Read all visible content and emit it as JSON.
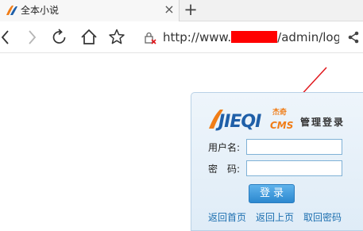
{
  "browser": {
    "tab": {
      "title": "全本小说",
      "close_label": "×"
    },
    "new_tab_label": "+",
    "address": {
      "url_prefix": "http://www.",
      "url_suffix": "/admin/login"
    }
  },
  "login": {
    "logo": {
      "brand": "JIEQI",
      "sub": "CMS",
      "small": "杰奇"
    },
    "title": "管理登录",
    "username_label": "用户名:",
    "password_label": "密　码:",
    "username_value": "",
    "password_value": "",
    "submit_label": "登录",
    "links": {
      "home": "返回首页",
      "prev": "返回上页",
      "retrieve": "取回密码"
    }
  },
  "colors": {
    "annotation_arrow": "#e0161b",
    "url_redaction": "#ff0000",
    "logo_orange": "#f07d17",
    "logo_blue": "#1f5fa8",
    "button_blue": "#2c88cf",
    "link_blue": "#1d6fb0"
  },
  "icons": {
    "back": "back-arrow-icon",
    "forward": "forward-arrow-icon",
    "refresh": "refresh-icon",
    "home": "home-icon",
    "favorite": "star-icon",
    "site_info": "blocked-lock-icon",
    "share": "share-icon"
  }
}
